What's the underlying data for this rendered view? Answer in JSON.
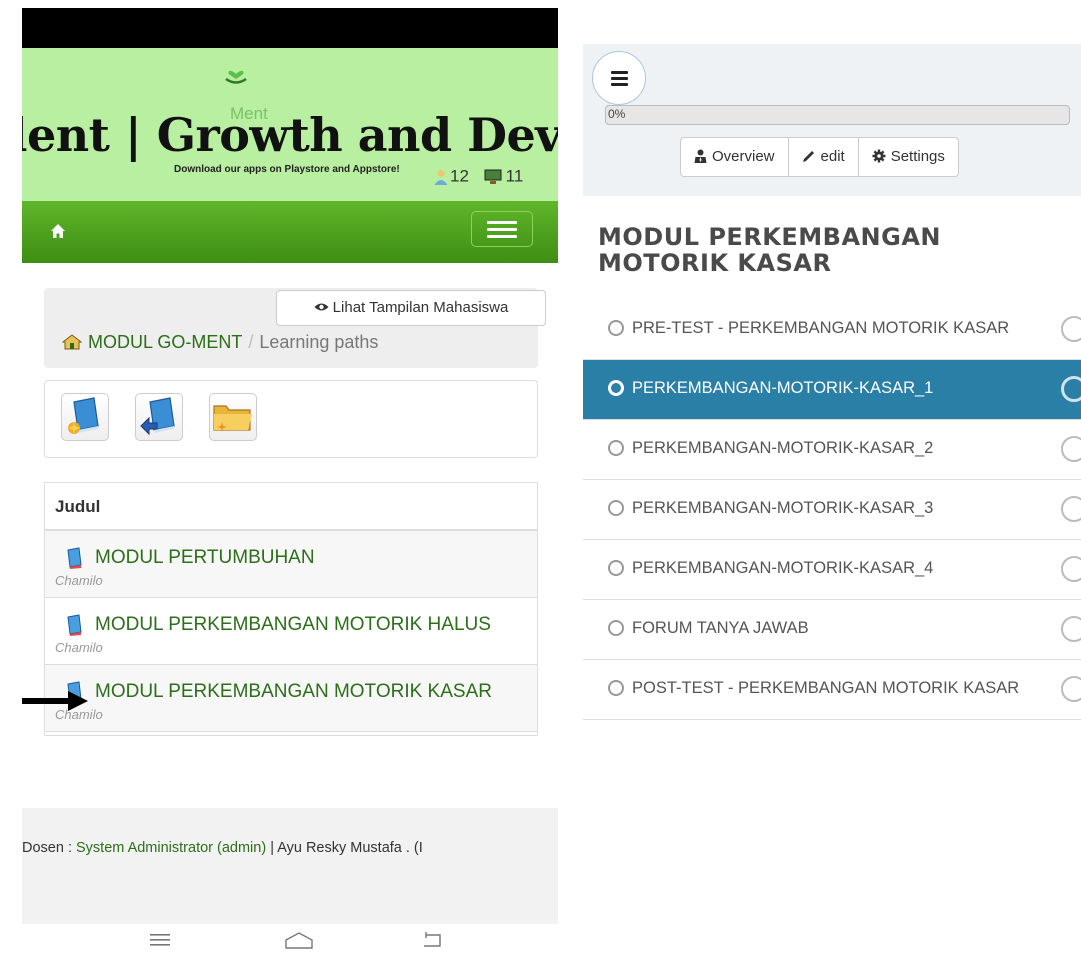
{
  "left": {
    "banner": {
      "title": "lent | Growth and Dev",
      "ghost": "Ment",
      "subtitle": "Download our apps on Playstore and Appstore!",
      "users_online": "12",
      "courses_online": "11"
    },
    "view_button": "Lihat Tampilan Mahasiswa",
    "breadcrumb": {
      "home": "MODUL GO-MENT",
      "separator": "/",
      "current": "Learning paths"
    },
    "table": {
      "header": "Judul",
      "rows": [
        {
          "title": "MODUL PERTUMBUHAN",
          "author": "Chamilo"
        },
        {
          "title": "MODUL PERKEMBANGAN MOTORIK HALUS",
          "author": "Chamilo"
        },
        {
          "title": "MODUL PERKEMBANGAN MOTORIK KASAR",
          "author": "Chamilo"
        }
      ]
    },
    "footer": {
      "prefix": "Dosen : ",
      "admin": "System Administrator (admin)",
      "divider": " | ",
      "teacher": "Ayu Resky Mustafa . (I"
    }
  },
  "right": {
    "progress": {
      "label": "0%",
      "value": 0
    },
    "buttons": {
      "overview": "Overview",
      "edit": "edit",
      "settings": "Settings"
    },
    "title": "MODUL PERKEMBANGAN MOTORIK KASAR",
    "items": [
      {
        "label": "PRE-TEST - PERKEMBANGAN MOTORIK KASAR",
        "active": false
      },
      {
        "label": "PERKEMBANGAN-MOTORIK-KASAR_1",
        "active": true
      },
      {
        "label": "PERKEMBANGAN-MOTORIK-KASAR_2",
        "active": false
      },
      {
        "label": "PERKEMBANGAN-MOTORIK-KASAR_3",
        "active": false
      },
      {
        "label": "PERKEMBANGAN-MOTORIK-KASAR_4",
        "active": false
      },
      {
        "label": "FORUM TANYA JAWAB",
        "active": false
      },
      {
        "label": "POST-TEST - PERKEMBANGAN MOTORIK KASAR",
        "active": false
      }
    ]
  },
  "colors": {
    "brand_green": "#4a9e1c",
    "link_green": "#2c6e1a",
    "active_blue": "#2a7fa6",
    "banner_green": "#b9efa0"
  }
}
